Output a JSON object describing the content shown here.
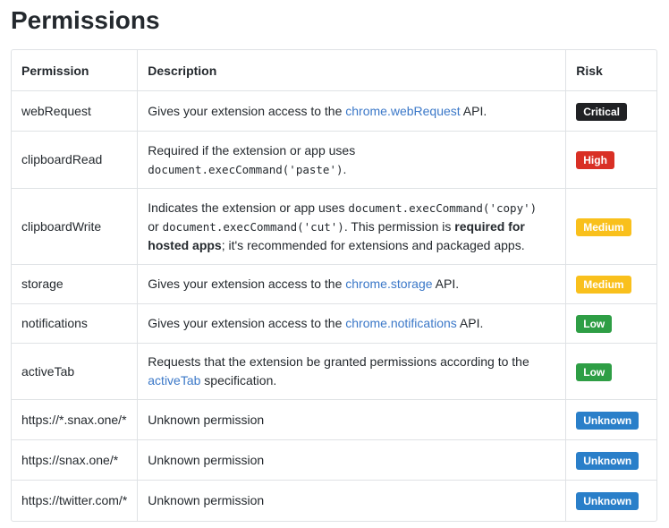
{
  "title": "Permissions",
  "headers": {
    "permission": "Permission",
    "description": "Description",
    "risk": "Risk"
  },
  "rows": [
    {
      "permission": "webRequest",
      "desc": {
        "p1": "Gives your extension access to the ",
        "link": "chrome.webRequest",
        "p2": " API."
      },
      "risk": "Critical"
    },
    {
      "permission": "clipboardRead",
      "desc": {
        "p1": "Required if the extension or app uses",
        "code": "document.execCommand('paste')",
        "p2": "."
      },
      "risk": "High"
    },
    {
      "permission": "clipboardWrite",
      "desc": {
        "p1": "Indicates the extension or app uses ",
        "code1": "document.execCommand('copy')",
        "p2": "or ",
        "code2": "document.execCommand('cut')",
        "p3": ". This permission is ",
        "bold": "required for hosted apps",
        "p4": "; it's recommended for extensions and packaged apps."
      },
      "risk": "Medium"
    },
    {
      "permission": "storage",
      "desc": {
        "p1": "Gives your extension access to the ",
        "link": "chrome.storage",
        "p2": " API."
      },
      "risk": "Medium"
    },
    {
      "permission": "notifications",
      "desc": {
        "p1": "Gives your extension access to the ",
        "link": "chrome.notifications",
        "p2": " API."
      },
      "risk": "Low"
    },
    {
      "permission": "activeTab",
      "desc": {
        "p1": "Requests that the extension be granted permissions according to the",
        "link": "activeTab",
        "p2": " specification."
      },
      "risk": "Low"
    },
    {
      "permission": "https://*.snax.one/*",
      "desc": {
        "p1": "Unknown permission"
      },
      "risk": "Unknown"
    },
    {
      "permission": "https://snax.one/*",
      "desc": {
        "p1": "Unknown permission"
      },
      "risk": "Unknown"
    },
    {
      "permission": "https://twitter.com/*",
      "desc": {
        "p1": "Unknown permission"
      },
      "risk": "Unknown"
    }
  ],
  "colors": {
    "critical": "#202124",
    "high": "#d93025",
    "medium": "#f9c01c",
    "low": "#2e9e45",
    "unknown": "#2a7fc9",
    "link": "#3b78c8"
  }
}
